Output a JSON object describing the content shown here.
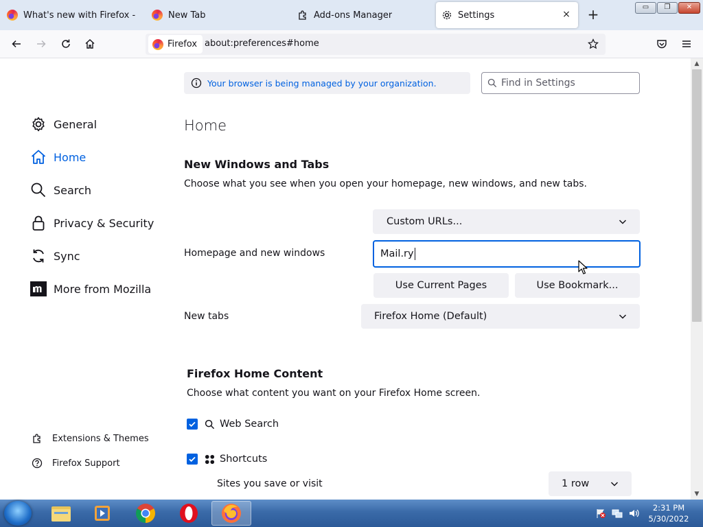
{
  "window": {
    "tabs": [
      {
        "label": "What's new with Firefox - More",
        "selected": false,
        "icon": "firefox-icon"
      },
      {
        "label": "New Tab",
        "selected": false,
        "icon": "firefox-icon"
      },
      {
        "label": "Add-ons Manager",
        "selected": false,
        "icon": "puzzle-icon"
      },
      {
        "label": "Settings",
        "selected": true,
        "icon": "gear-icon"
      }
    ],
    "controls": {
      "minimize": "▭",
      "maximize": "❐",
      "close": "✕"
    }
  },
  "navbar": {
    "identity_label": "Firefox",
    "url": "about:preferences#home"
  },
  "settings": {
    "policy_notice": "Your browser is being managed by your organization.",
    "search_placeholder": "Find in Settings",
    "categories": [
      {
        "label": "General",
        "icon": "gear-icon",
        "selected": false
      },
      {
        "label": "Home",
        "icon": "home-icon",
        "selected": true
      },
      {
        "label": "Search",
        "icon": "search-icon",
        "selected": false
      },
      {
        "label": "Privacy & Security",
        "icon": "lock-icon",
        "selected": false
      },
      {
        "label": "Sync",
        "icon": "sync-icon",
        "selected": false
      },
      {
        "label": "More from Mozilla",
        "icon": "mozilla-icon",
        "selected": false
      }
    ],
    "footer_links": [
      {
        "label": "Extensions & Themes",
        "icon": "puzzle-icon"
      },
      {
        "label": "Firefox Support",
        "icon": "help-icon"
      }
    ],
    "page_title": "Home",
    "new_windows": {
      "heading": "New Windows and Tabs",
      "description": "Choose what you see when you open your homepage, new windows, and new tabs.",
      "homepage_label": "Homepage and new windows",
      "homepage_mode": "Custom URLs...",
      "homepage_value": "Mail.ry",
      "use_current_pages": "Use Current Pages",
      "use_bookmark": "Use Bookmark...",
      "newtabs_label": "New tabs",
      "newtabs_value": "Firefox Home (Default)"
    },
    "home_content": {
      "heading": "Firefox Home Content",
      "description": "Choose what content you want on your Firefox Home screen.",
      "web_search": {
        "label": "Web Search",
        "checked": true,
        "icon": "search-icon"
      },
      "shortcuts": {
        "label": "Shortcuts",
        "checked": true,
        "icon": "grid-icon"
      },
      "sites_label": "Sites you save or visit",
      "rows_value": "1 row"
    }
  },
  "taskbar": {
    "apps": [
      "start-orb",
      "file-explorer-icon",
      "media-player-icon",
      "chrome-icon",
      "opera-icon",
      "firefox-icon"
    ],
    "time": "2:31 PM",
    "date": "5/30/2022"
  },
  "colors": {
    "accent": "#0061e0",
    "tabstrip": "#dfe8f4",
    "taskbar": "#3a6aa8"
  }
}
